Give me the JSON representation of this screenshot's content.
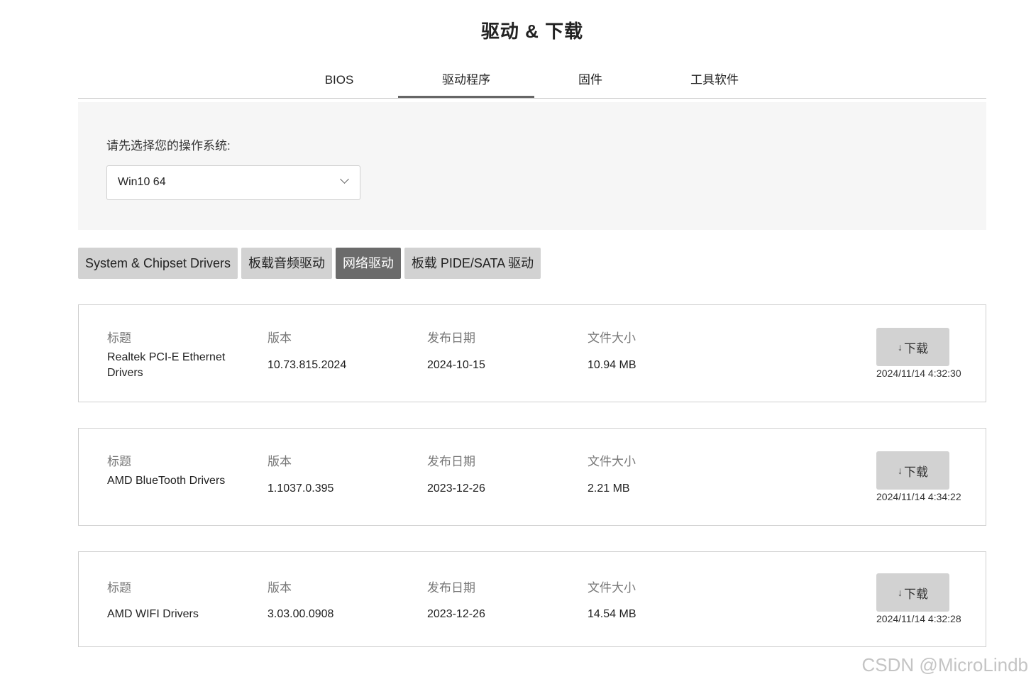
{
  "page": {
    "title": "驱动 & 下载"
  },
  "tabs": [
    {
      "label": "BIOS"
    },
    {
      "label": "驱动程序",
      "active": true
    },
    {
      "label": "固件"
    },
    {
      "label": "工具软件"
    }
  ],
  "os_selector": {
    "label": "请先选择您的操作系统:",
    "value": "Win10 64"
  },
  "categories": [
    {
      "label": "System & Chipset Drivers"
    },
    {
      "label": "板载音频驱动"
    },
    {
      "label": "网络驱动",
      "active": true
    },
    {
      "label": "板载 PIDE/SATA 驱动"
    }
  ],
  "columns": {
    "title": "标题",
    "version": "版本",
    "date": "发布日期",
    "size": "文件大小"
  },
  "download_label": "下载",
  "drivers": [
    {
      "title": "Realtek PCI-E Ethernet Drivers",
      "version": "10.73.815.2024",
      "date": "2024-10-15",
      "size": "10.94 MB",
      "stamp": "2024/11/14 4:32:30"
    },
    {
      "title": "AMD BlueTooth Drivers",
      "version": "1.1037.0.395",
      "date": "2023-12-26",
      "size": "2.21 MB",
      "stamp": "2024/11/14 4:34:22"
    },
    {
      "title": "AMD WIFI Drivers",
      "version": "3.03.00.0908",
      "date": "2023-12-26",
      "size": "14.54 MB",
      "stamp": "2024/11/14 4:32:28"
    }
  ],
  "watermark": "CSDN @MicroLindb"
}
